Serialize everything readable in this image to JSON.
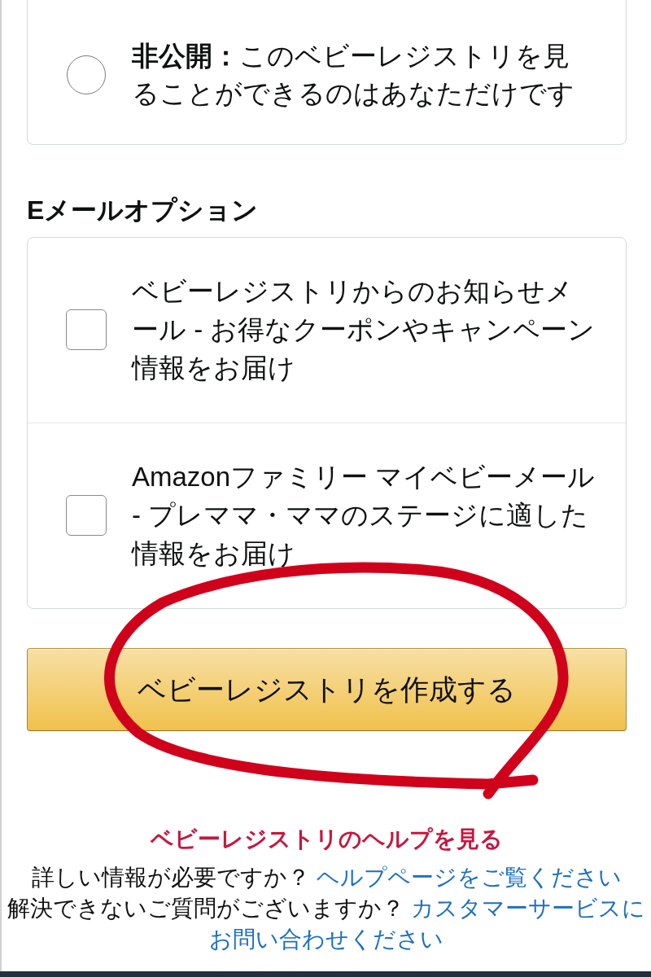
{
  "visibility": {
    "options": [
      {
        "label": "**非公開：**このベビーレジストリを見ることができるのはあなただけです",
        "selected": false
      }
    ]
  },
  "email_options": {
    "heading": "Eメールオプション",
    "options": [
      {
        "label": "ベビーレジストリからのお知らせメール - お得なクーポンやキャンペーン情報をお届け",
        "checked": false
      },
      {
        "label": "Amazonファミリー マイベビーメール - プレママ・ママのステージに適した情報をお届け",
        "checked": false
      }
    ]
  },
  "create_button": {
    "label": "ベビーレジストリを作成する"
  },
  "help": {
    "title": "ベビーレジストリのヘルプを見る",
    "lines": [
      [
        {
          "kind": "text",
          "text": "詳しい情報が必要ですか？"
        },
        {
          "kind": "link",
          "text": "ヘルプページをご覧ください"
        }
      ],
      [
        {
          "kind": "text",
          "text": "解決できないご質問がございますか？"
        },
        {
          "kind": "link",
          "text": "カスタマーサービスに"
        }
      ],
      [
        {
          "kind": "link",
          "text": "お問い合わせください"
        }
      ]
    ]
  }
}
